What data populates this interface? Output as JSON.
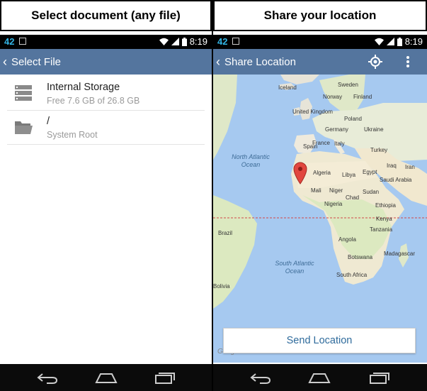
{
  "left": {
    "caption": "Select document (any file)",
    "status": {
      "number": "42",
      "time": "8:19"
    },
    "appbar": {
      "title": "Select File"
    },
    "items": [
      {
        "title": "Internal Storage",
        "subtitle": "Free 7.6 GB of 26.8 GB",
        "icon": "storage-icon"
      },
      {
        "title": "/",
        "subtitle": "System Root",
        "icon": "folder-icon"
      }
    ]
  },
  "right": {
    "caption": "Share your location",
    "status": {
      "number": "42",
      "time": "8:19"
    },
    "appbar": {
      "title": "Share Location"
    },
    "map": {
      "labels": {
        "iceland": "Iceland",
        "sweden": "Sweden",
        "norway": "Norway",
        "finland": "Finland",
        "uk": "United Kingdom",
        "poland": "Poland",
        "germany": "Germany",
        "ukraine": "Ukraine",
        "france": "France",
        "italy": "Italy",
        "spain": "Spain",
        "turkey": "Turkey",
        "north_atlantic": "North Atlantic Ocean",
        "algeria": "Algeria",
        "libya": "Libya",
        "egypt": "Egypt",
        "iraq": "Iraq",
        "iran": "Iran",
        "saudi": "Saudi Arabia",
        "mali": "Mali",
        "niger": "Niger",
        "chad": "Chad",
        "sudan": "Sudan",
        "nigeria": "Nigeria",
        "ethiopia": "Ethiopia",
        "kenya": "Kenya",
        "brazil": "Brazil",
        "tanzania": "Tanzania",
        "angola": "Angola",
        "madagascar": "Madagascar",
        "botswana": "Botswana",
        "south_atlantic": "South Atlantic Ocean",
        "south_africa": "South Africa",
        "bolivia": "Bolivia",
        "google": "Google"
      }
    },
    "send_label": "Send Location"
  }
}
